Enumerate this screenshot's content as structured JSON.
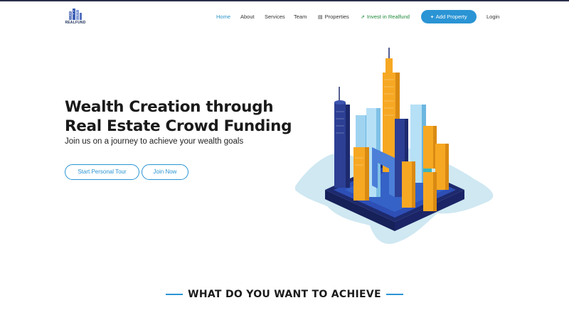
{
  "brand": {
    "name": "REALFUND"
  },
  "nav": {
    "items": [
      {
        "label": "Home",
        "active": true
      },
      {
        "label": "About"
      },
      {
        "label": "Services"
      },
      {
        "label": "Team"
      },
      {
        "label": "Properties",
        "icon": "building-icon"
      },
      {
        "label": "Invest in Realfund",
        "icon": "chart-up-icon"
      }
    ],
    "add_property": {
      "label": "Add Property",
      "icon": "plus-icon"
    },
    "login": "Login"
  },
  "hero": {
    "title_line1": "Wealth Creation through",
    "title_line2": "Real Estate Crowd Funding",
    "subtitle": "Join us on a journey to achieve your wealth goals",
    "tour_button": "Start Personal Tour",
    "join_button": "Join Now",
    "illustration": "isometric-city-skyscrapers"
  },
  "section": {
    "heading": "WHAT DO YOU WANT TO ACHIEVE"
  },
  "colors": {
    "accent": "#2a94d4",
    "invest_green": "#1f8a3a",
    "dark_navy": "#1e2a6e",
    "orange": "#f7a823"
  }
}
